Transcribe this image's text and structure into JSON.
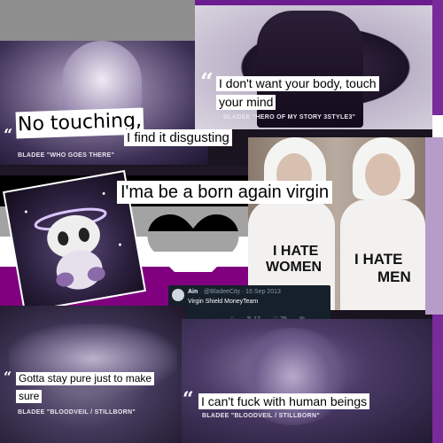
{
  "quotes": {
    "q1": {
      "text": "I don't want your body, touch your mind",
      "line1": "I don't want your body, touch",
      "line2": "your mind",
      "credit": "BLADEE \"HERO OF MY STORY 3STYLE3\""
    },
    "q2": {
      "big": "No touching,",
      "rest": "I find it disgusting",
      "credit": "BLADEE \"WHO GOES THERE\""
    },
    "q3": {
      "text": "I'ma be a born again virgin"
    },
    "q4": {
      "line1": "Gotta stay pure just to make",
      "line2": "sure",
      "credit": "BLADEE \"BLOODVEIL / STILLBORN\""
    },
    "q5": {
      "text": "I can't fuck with human beings",
      "credit": "BLADEE \"BLOODVEIL / STILLBORN\""
    }
  },
  "shirts": {
    "left": "I HATE WOMEN",
    "left_l1": "I HATE",
    "left_l2": "WOMEN",
    "right_l1": "I HATE",
    "right_l2": "MEN"
  },
  "tweet": {
    "name": "Ain",
    "handle": "@BladeeCity · 16 Sep 2013",
    "text": "Virgin Shield MoneyTeam",
    "retweets": "17",
    "likes": "25"
  },
  "flag_colors": [
    "#000000",
    "#a3a3a3",
    "#ffffff",
    "#800080"
  ]
}
